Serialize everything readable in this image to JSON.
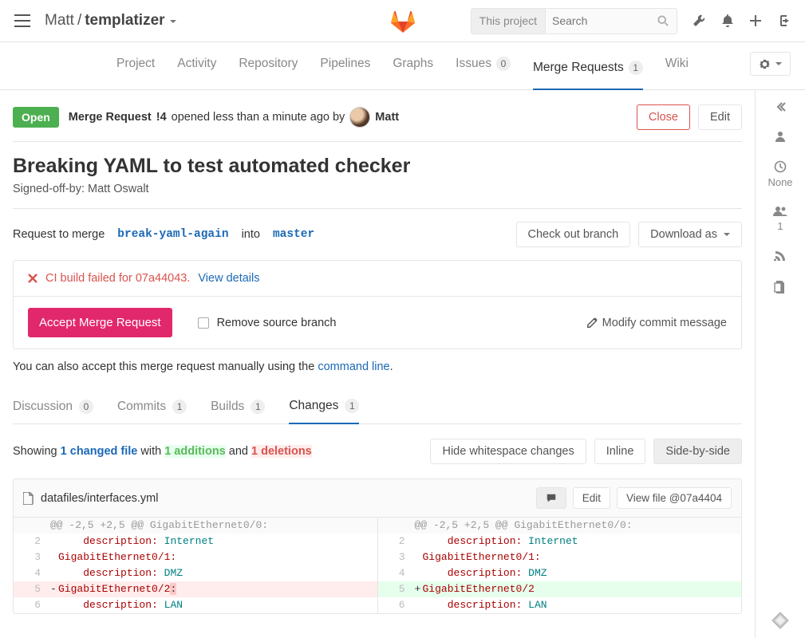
{
  "top": {
    "owner": "Matt",
    "project": "templatizer",
    "search_scope": "This project",
    "search_placeholder": "Search"
  },
  "tabs": {
    "project": "Project",
    "activity": "Activity",
    "repository": "Repository",
    "pipelines": "Pipelines",
    "graphs": "Graphs",
    "issues": "Issues",
    "issues_count": "0",
    "merge_requests": "Merge Requests",
    "merge_requests_count": "1",
    "wiki": "Wiki"
  },
  "header": {
    "status": "Open",
    "prefix": "Merge Request",
    "id": "!4",
    "opened_text": "opened less than a minute ago by",
    "author": "Matt",
    "close": "Close",
    "edit": "Edit"
  },
  "mr": {
    "title": "Breaking YAML to test automated checker",
    "signed_off": "Signed-off-by: Matt Oswalt",
    "request_to_merge": "Request to merge",
    "source_branch": "break-yaml-again",
    "into": "into",
    "target_branch": "master",
    "check_out_branch": "Check out branch",
    "download_as": "Download as"
  },
  "ci": {
    "text_prefix": "CI build failed for ",
    "sha": "07a44043",
    "dot": ".",
    "view_details": "View details"
  },
  "merge_box": {
    "accept": "Accept Merge Request",
    "remove_source": "Remove source branch",
    "modify_commit": "Modify commit message"
  },
  "manual": {
    "prefix": "You can also accept this merge request manually using the ",
    "link": "command line",
    "suffix": "."
  },
  "changetabs": {
    "discussion": "Discussion",
    "discussion_count": "0",
    "commits": "Commits",
    "commits_count": "1",
    "builds": "Builds",
    "builds_count": "1",
    "changes": "Changes",
    "changes_count": "1"
  },
  "summary": {
    "showing": "Showing ",
    "changed_file": "1 changed file",
    "with": " with ",
    "additions": "1 additions",
    "and": " and ",
    "deletions": "1 deletions"
  },
  "view_buttons": {
    "hide_ws": "Hide whitespace changes",
    "inline": "Inline",
    "sbs": "Side-by-side"
  },
  "file": {
    "path": "datafiles/interfaces.yml",
    "edit": "Edit",
    "view_file": "View file @07a4404"
  },
  "diff": {
    "hunk": "@@ -2,5 +2,5 @@ GigabitEthernet0/0:",
    "left": {
      "l2": {
        "n": "2",
        "indent": "    ",
        "k": "description:",
        "s": " Internet"
      },
      "l3": {
        "n": "3",
        "indent": "",
        "k": "GigabitEthernet0/1:",
        "s": ""
      },
      "l4": {
        "n": "4",
        "indent": "    ",
        "k": "description:",
        "s": " DMZ"
      },
      "l5": {
        "n": "5",
        "k": "GigabitEthernet0/2",
        "trail": ":"
      },
      "l6": {
        "n": "6",
        "indent": "    ",
        "k": "description:",
        "s": " LAN"
      }
    },
    "right": {
      "l2": {
        "n": "2",
        "indent": "    ",
        "k": "description:",
        "s": " Internet"
      },
      "l3": {
        "n": "3",
        "indent": "",
        "k": "GigabitEthernet0/1:",
        "s": ""
      },
      "l4": {
        "n": "4",
        "indent": "    ",
        "k": "description:",
        "s": " DMZ"
      },
      "l5": {
        "n": "5",
        "k": "GigabitEthernet0/2"
      },
      "l6": {
        "n": "6",
        "indent": "    ",
        "k": "description:",
        "s": " LAN"
      }
    }
  },
  "rightbar": {
    "none": "None",
    "one": "1"
  }
}
